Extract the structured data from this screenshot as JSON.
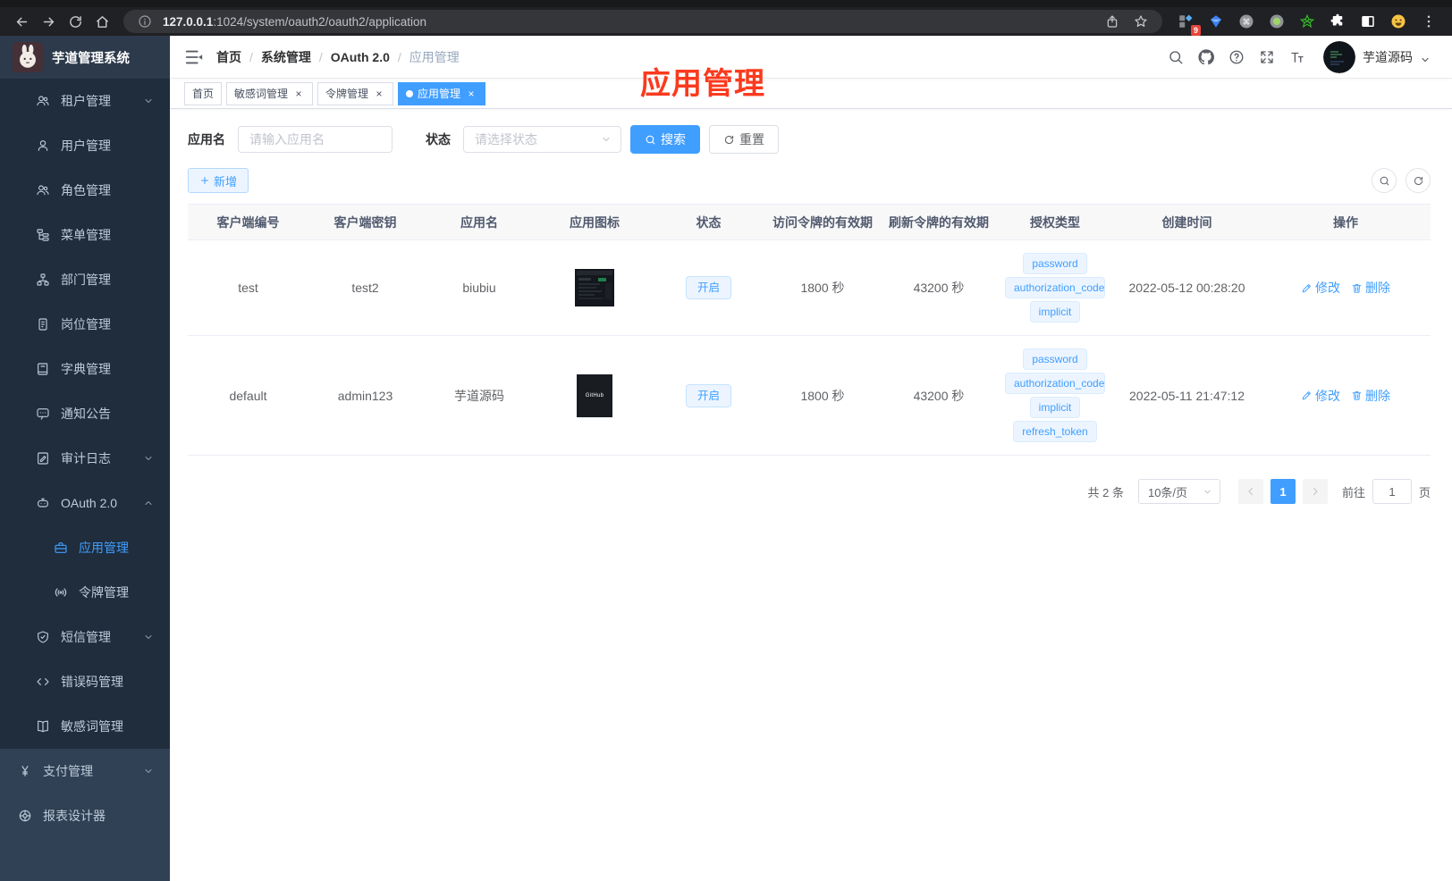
{
  "browser": {
    "url_host": "127.0.0.1",
    "url_path": ":1024/system/oauth2/oauth2/application",
    "extension_badge": "9"
  },
  "annotation": {
    "text": "应用管理"
  },
  "sidebar": {
    "title": "芋道管理系统",
    "items": [
      {
        "label": "租户管理",
        "icon": "tenant-users-icon",
        "level": 1,
        "chevron": "down"
      },
      {
        "label": "用户管理",
        "icon": "user-icon",
        "level": 1
      },
      {
        "label": "角色管理",
        "icon": "roles-icon",
        "level": 1
      },
      {
        "label": "菜单管理",
        "icon": "menu-tree-icon",
        "level": 1
      },
      {
        "label": "部门管理",
        "icon": "org-chart-icon",
        "level": 1
      },
      {
        "label": "岗位管理",
        "icon": "post-badge-icon",
        "level": 1
      },
      {
        "label": "字典管理",
        "icon": "dictionary-icon",
        "level": 1
      },
      {
        "label": "通知公告",
        "icon": "announcement-icon",
        "level": 1
      },
      {
        "label": "审计日志",
        "icon": "audit-log-icon",
        "level": 1,
        "chevron": "down"
      },
      {
        "label": "OAuth 2.0",
        "icon": "oauth-robot-icon",
        "level": 1,
        "chevron": "up"
      },
      {
        "label": "应用管理",
        "icon": "application-icon",
        "level": 2,
        "active": true
      },
      {
        "label": "令牌管理",
        "icon": "token-signal-icon",
        "level": 2
      },
      {
        "label": "短信管理",
        "icon": "sms-shield-icon",
        "level": 1,
        "chevron": "down"
      },
      {
        "label": "错误码管理",
        "icon": "error-code-icon",
        "level": 1
      },
      {
        "label": "敏感词管理",
        "icon": "sensitive-word-icon",
        "level": 1
      },
      {
        "label": "支付管理",
        "icon": "payment-yen-icon",
        "level": 0,
        "chevron": "down"
      },
      {
        "label": "报表设计器",
        "icon": "report-designer-icon",
        "level": 0
      }
    ]
  },
  "navbar": {
    "breadcrumb": [
      "首页",
      "系统管理",
      "OAuth 2.0",
      "应用管理"
    ],
    "username": "芋道源码"
  },
  "tabs": [
    {
      "label": "首页",
      "closable": false,
      "active": false
    },
    {
      "label": "敏感词管理",
      "closable": true,
      "active": false
    },
    {
      "label": "令牌管理",
      "closable": true,
      "active": false
    },
    {
      "label": "应用管理",
      "closable": true,
      "active": true
    }
  ],
  "query": {
    "name_label": "应用名",
    "name_placeholder": "请输入应用名",
    "status_label": "状态",
    "status_placeholder": "请选择状态",
    "search_label": "搜索",
    "reset_label": "重置",
    "add_label": "新增"
  },
  "table": {
    "headers": [
      "客户端编号",
      "客户端密钥",
      "应用名",
      "应用图标",
      "状态",
      "访问令牌的有效期",
      "刷新令牌的有效期",
      "授权类型",
      "创建时间",
      "操作"
    ],
    "edit_label": "修改",
    "delete_label": "删除",
    "rows": [
      {
        "client_id": "test",
        "client_secret": "test2",
        "app_name": "biubiu",
        "app_icon": "screenshot-thumb",
        "status": "开启",
        "access_token_ttl": "1800 秒",
        "refresh_token_ttl": "43200 秒",
        "grant_types": [
          "password",
          "authorization_code",
          "implicit"
        ],
        "created_at": "2022-05-12 00:28:20"
      },
      {
        "client_id": "default",
        "client_secret": "admin123",
        "app_name": "芋道源码",
        "app_icon": "github-thumb",
        "app_icon_label": "GitHub",
        "status": "开启",
        "access_token_ttl": "1800 秒",
        "refresh_token_ttl": "43200 秒",
        "grant_types": [
          "password",
          "authorization_code",
          "implicit",
          "refresh_token"
        ],
        "created_at": "2022-05-11 21:47:12"
      }
    ]
  },
  "pagination": {
    "total": "共 2 条",
    "page_size": "10条/页",
    "current_page": "1",
    "goto_label": "前往",
    "goto_value": "1",
    "unit_label": "页"
  }
}
